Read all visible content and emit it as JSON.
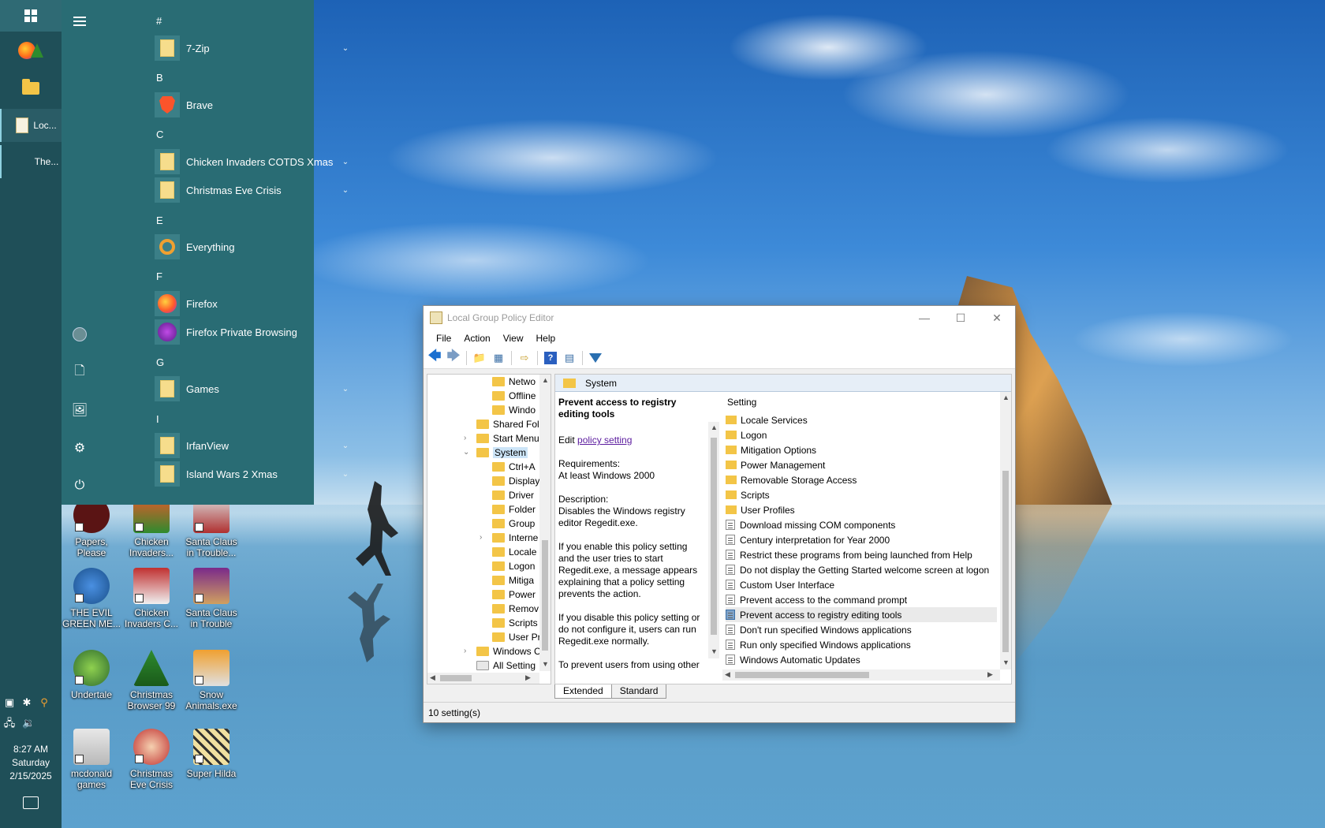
{
  "taskbar": {
    "window_buttons": [
      {
        "label": "Loc..."
      },
      {
        "label": "The..."
      }
    ],
    "clock": {
      "time": "8:27 AM",
      "day": "Saturday",
      "date": "2/15/2025"
    }
  },
  "start_menu": {
    "groups": [
      {
        "letter": "#",
        "apps": [
          {
            "name": "7-Zip",
            "expandable": true,
            "icon": "folder-icon"
          }
        ]
      },
      {
        "letter": "B",
        "apps": [
          {
            "name": "Brave",
            "expandable": false,
            "icon": "brave-icon"
          }
        ]
      },
      {
        "letter": "C",
        "apps": [
          {
            "name": "Chicken Invaders COTDS Xmas",
            "expandable": true,
            "icon": "folder-icon"
          },
          {
            "name": "Christmas Eve Crisis",
            "expandable": true,
            "icon": "folder-icon"
          }
        ]
      },
      {
        "letter": "E",
        "apps": [
          {
            "name": "Everything",
            "expandable": false,
            "icon": "search-icon"
          }
        ]
      },
      {
        "letter": "F",
        "apps": [
          {
            "name": "Firefox",
            "expandable": false,
            "icon": "firefox-icon"
          },
          {
            "name": "Firefox Private Browsing",
            "expandable": false,
            "icon": "firefox-private-icon"
          }
        ]
      },
      {
        "letter": "G",
        "apps": [
          {
            "name": "Games",
            "expandable": true,
            "icon": "folder-icon"
          }
        ]
      },
      {
        "letter": "I",
        "apps": [
          {
            "name": "IrfanView",
            "expandable": true,
            "icon": "folder-icon"
          },
          {
            "name": "Island Wars 2 Xmas",
            "expandable": true,
            "icon": "folder-icon"
          }
        ]
      }
    ]
  },
  "desktop_icons": [
    {
      "label": "Papers, Please"
    },
    {
      "label": "Chicken Invaders..."
    },
    {
      "label": "Santa Claus in Trouble..."
    },
    {
      "label": "THE EVIL GREEN ME..."
    },
    {
      "label": "Chicken Invaders C..."
    },
    {
      "label": "Santa Claus in Trouble"
    },
    {
      "label": "Undertale"
    },
    {
      "label": "Christmas Browser 99"
    },
    {
      "label": "Snow Animals.exe"
    },
    {
      "label": "mcdonald games"
    },
    {
      "label": "Christmas Eve Crisis"
    },
    {
      "label": "Super Hilda"
    }
  ],
  "gpedit": {
    "title": "Local Group Policy Editor",
    "menu": [
      "File",
      "Action",
      "View",
      "Help"
    ],
    "tree": [
      {
        "label": "Netwo"
      },
      {
        "label": "Offline"
      },
      {
        "label": "Windo"
      },
      {
        "label": "Shared Fol"
      },
      {
        "label": "Start Menu"
      },
      {
        "label": "System"
      },
      {
        "label": "Ctrl+A"
      },
      {
        "label": "Display"
      },
      {
        "label": "Driver"
      },
      {
        "label": "Folder"
      },
      {
        "label": "Group"
      },
      {
        "label": "Interne"
      },
      {
        "label": "Locale"
      },
      {
        "label": "Logon"
      },
      {
        "label": "Mitiga"
      },
      {
        "label": "Power"
      },
      {
        "label": "Remov"
      },
      {
        "label": "Scripts"
      },
      {
        "label": "User Pr"
      },
      {
        "label": "Windows C"
      },
      {
        "label": "All Setting"
      }
    ],
    "header_title": "System",
    "description": {
      "title": "Prevent access to registry editing tools",
      "edit_prefix": "Edit",
      "edit_link": "policy setting",
      "requirements_label": "Requirements:",
      "requirements_value": "At least Windows 2000",
      "description_label": "Description:",
      "description_value": "Disables the Windows registry editor Regedit.exe.",
      "para1": "If you enable this policy setting and the user tries to start Regedit.exe, a message appears explaining that a policy setting prevents the action.",
      "para2": "If you disable this policy setting or do not configure it, users can run Regedit.exe normally.",
      "para3": "To prevent users from using other administrative tools, use the \"Run"
    },
    "column_header": "Setting",
    "settings": [
      {
        "label": "Locale Services",
        "type": "folder"
      },
      {
        "label": "Logon",
        "type": "folder"
      },
      {
        "label": "Mitigation Options",
        "type": "folder"
      },
      {
        "label": "Power Management",
        "type": "folder"
      },
      {
        "label": "Removable Storage Access",
        "type": "folder"
      },
      {
        "label": "Scripts",
        "type": "folder"
      },
      {
        "label": "User Profiles",
        "type": "folder"
      },
      {
        "label": "Download missing COM components",
        "type": "policy"
      },
      {
        "label": "Century interpretation for Year 2000",
        "type": "policy"
      },
      {
        "label": "Restrict these programs from being launched from Help",
        "type": "policy"
      },
      {
        "label": "Do not display the Getting Started welcome screen at logon",
        "type": "policy"
      },
      {
        "label": "Custom User Interface",
        "type": "policy"
      },
      {
        "label": "Prevent access to the command prompt",
        "type": "policy"
      },
      {
        "label": "Prevent access to registry editing tools",
        "type": "policy",
        "selected": true
      },
      {
        "label": "Don't run specified Windows applications",
        "type": "policy"
      },
      {
        "label": "Run only specified Windows applications",
        "type": "policy"
      },
      {
        "label": "Windows Automatic Updates",
        "type": "policy"
      }
    ],
    "tabs": [
      "Extended",
      "Standard"
    ],
    "status": "10 setting(s)"
  }
}
